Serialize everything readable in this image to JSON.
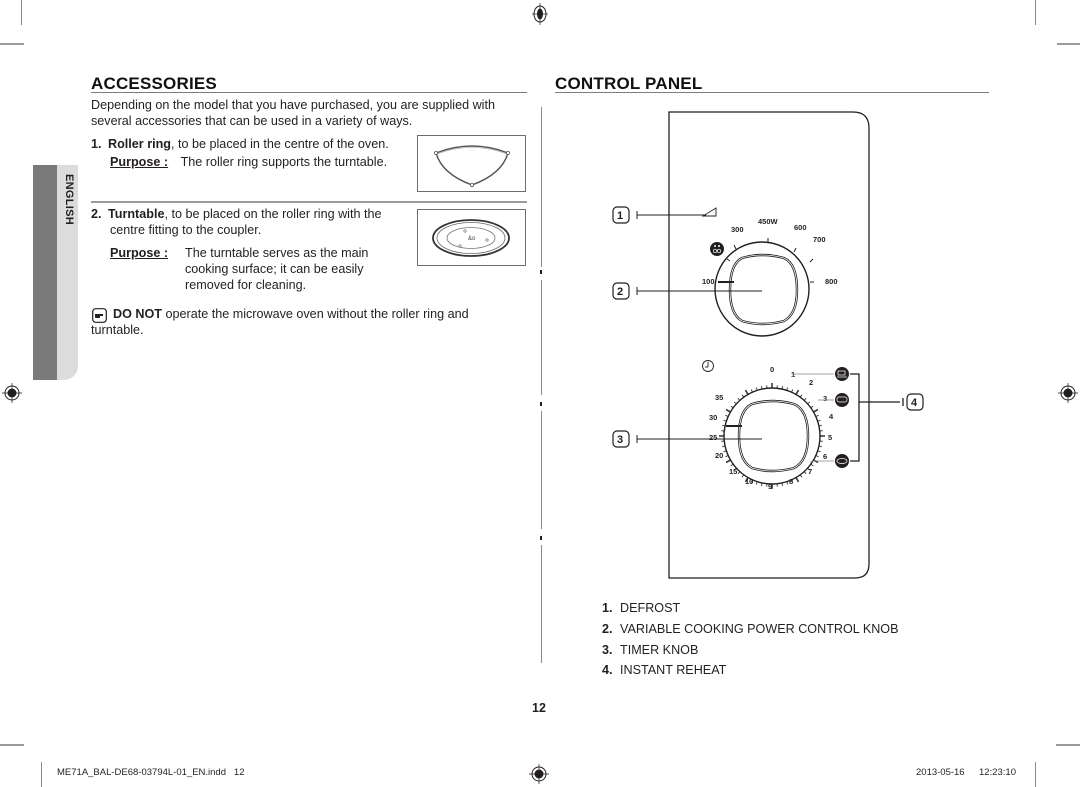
{
  "page": {
    "number": "12",
    "language_tab": "ENGLISH"
  },
  "accessories": {
    "title": "ACCESSORIES",
    "intro_line1": "Depending on the model that you have purchased, you are supplied with",
    "intro_line2": "several accessories that can be used in a variety of ways.",
    "items": [
      {
        "num": "1.",
        "name": "Roller ring",
        "desc": ", to be placed in the centre of the oven.",
        "purpose_label": "Purpose :",
        "purpose_line1": "The roller ring supports the turntable.",
        "image": "roller-ring-illustration"
      },
      {
        "num": "2.",
        "name": "Turntable",
        "desc": ", to be placed on the roller ring with the",
        "desc_line2": "centre fitting to the coupler.",
        "purpose_label": "Purpose :",
        "purpose_line1": "The turntable serves as the main",
        "purpose_line2": "cooking surface; it can be easily",
        "purpose_line3": "removed for cleaning.",
        "image": "turntable-illustration"
      }
    ],
    "note": {
      "icon": "pointing-hand-icon",
      "bold": "DO NOT",
      "text": " operate the microwave oven without the roller ring and",
      "text_line2": "turntable."
    }
  },
  "control_panel": {
    "title": "CONTROL PANEL",
    "power_knob": {
      "labels": [
        "100",
        "300",
        "450W",
        "600",
        "700",
        "800"
      ],
      "defrost_icon": "defrost-icon"
    },
    "timer_knob": {
      "labels": [
        "0",
        "1",
        "2",
        "3",
        "4",
        "5",
        "6",
        "7",
        "8",
        "9",
        "10",
        "15",
        "20",
        "25",
        "30",
        "35"
      ],
      "clock_icon": "clock-icon",
      "reheat_icons": [
        "cup-reheat-icon",
        "plate-reheat-icon",
        "dish-reheat-icon"
      ]
    },
    "callouts": [
      "1",
      "2",
      "3",
      "4"
    ],
    "legend": [
      {
        "num": "1.",
        "label": "DEFROST"
      },
      {
        "num": "2.",
        "label": "VARIABLE COOKING POWER CONTROL KNOB"
      },
      {
        "num": "3.",
        "label": "TIMER KNOB"
      },
      {
        "num": "4.",
        "label": "INSTANT REHEAT"
      }
    ]
  },
  "footer": {
    "filename": "ME71A_BAL-DE68-03794L-01_EN.indd   12",
    "date": "2013-05-16",
    "time": "12:23:10"
  }
}
